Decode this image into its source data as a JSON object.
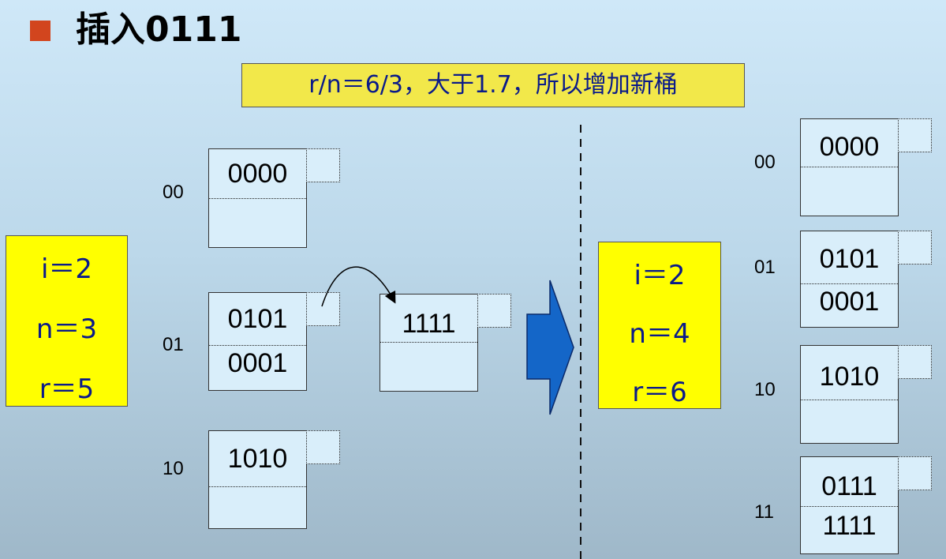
{
  "header": {
    "title": "插入0111"
  },
  "note": "r/n＝6/3，大于1.7，所以增加新桶",
  "before": {
    "params": {
      "i": "i＝2",
      "n": "n＝3",
      "r": "r＝5"
    },
    "buckets": [
      {
        "label": "00",
        "values": [
          "0000",
          ""
        ]
      },
      {
        "label": "01",
        "values": [
          "0101",
          "0001"
        ]
      },
      {
        "label": "10",
        "values": [
          "1010",
          ""
        ]
      }
    ],
    "overflow": {
      "values": [
        "1111",
        ""
      ]
    }
  },
  "after": {
    "params": {
      "i": "i＝2",
      "n": "n＝4",
      "r": "r＝6"
    },
    "buckets": [
      {
        "label": "00",
        "values": [
          "0000",
          ""
        ]
      },
      {
        "label": "01",
        "values": [
          "0101",
          "0001"
        ]
      },
      {
        "label": "10",
        "values": [
          "1010",
          ""
        ]
      },
      {
        "label": "11",
        "values": [
          "0111",
          "1111"
        ]
      }
    ]
  },
  "colors": {
    "bullet": "#d2451e",
    "note_bg": "#f2e84a",
    "param_bg": "#ffff00",
    "bucket_bg": "#d9eefa",
    "arrow": "#1466c8"
  }
}
